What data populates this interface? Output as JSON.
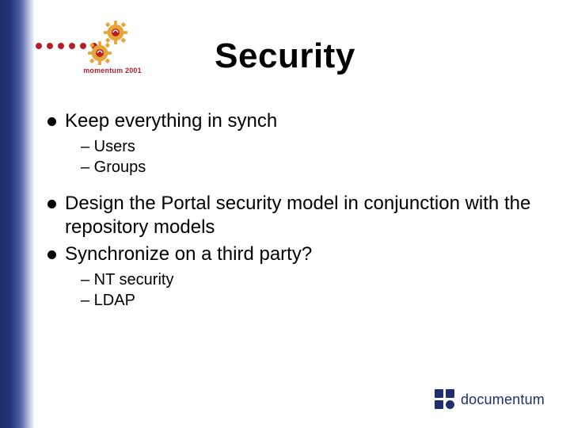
{
  "header": {
    "title": "Security",
    "badge_label": "momentum 2001"
  },
  "bullets": {
    "b1": {
      "text": "Keep everything in synch",
      "sub": {
        "s1": "– Users",
        "s2": "– Groups"
      }
    },
    "b2": {
      "text": "Design the Portal security model in conjunction with the repository models"
    },
    "b3": {
      "text": "Synchronize on a third party?",
      "sub": {
        "s1": "– NT security",
        "s2": "– LDAP"
      }
    }
  },
  "footer": {
    "logo_text": "documentum"
  },
  "colors": {
    "accent_red": "#b41f2a",
    "brand_navy": "#1f2f6d",
    "side_dark": "#1a2d6b"
  }
}
